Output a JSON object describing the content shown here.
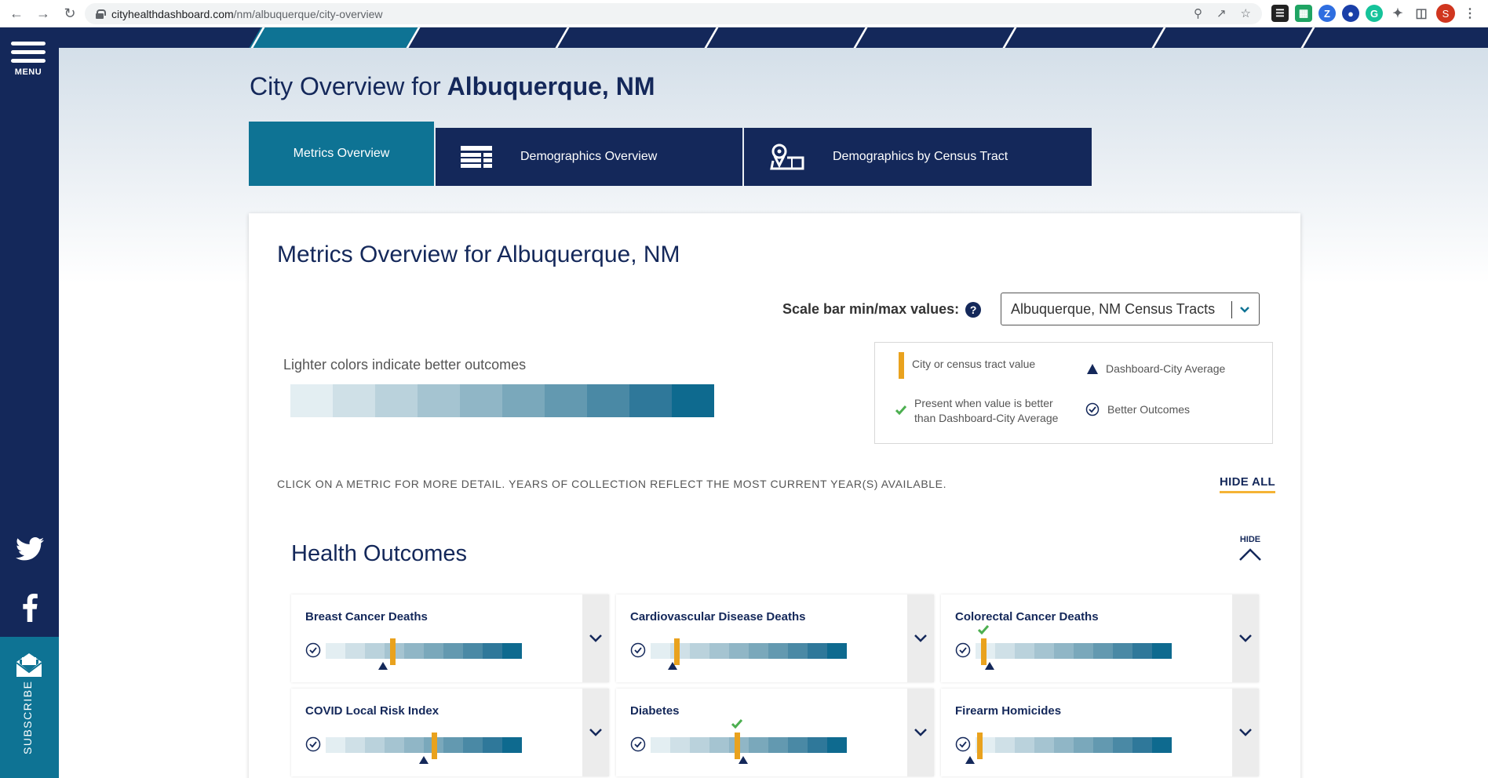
{
  "browser": {
    "url_host": "cityhealthdashboard.com",
    "url_path": "/nm/albuquerque/city-overview",
    "profile_initial": "S"
  },
  "sidebar": {
    "menu_label": "MENU",
    "subscribe_label": "SUBSCRIBE"
  },
  "page": {
    "heading_prefix": "City Overview for",
    "heading_city": "Albuquerque, NM"
  },
  "tabs": [
    {
      "label": "Metrics Overview",
      "icon": "none",
      "active": true
    },
    {
      "label": "Demographics Overview",
      "icon": "table-icon",
      "active": false
    },
    {
      "label": "Demographics by Census Tract",
      "icon": "map-pin-icon",
      "active": false
    }
  ],
  "overview": {
    "title": "Metrics Overview for Albuquerque, NM",
    "scale_label": "Scale bar min/max values:",
    "scale_select_value": "Albuquerque, NM Census Tracts",
    "lighter_label": "Lighter colors indicate better outcomes",
    "scale_colors": [
      "#e3eef2",
      "#cfe0e7",
      "#bad2dc",
      "#a5c4d1",
      "#90b6c6",
      "#7aa8bb",
      "#6399b0",
      "#4a89a5",
      "#2f789a",
      "#0e6a8f"
    ],
    "legend": {
      "tract_value": "City or census tract value",
      "city_average": "Dashboard-City Average",
      "better_than_avg": "Present when value is better than Dashboard-City Average",
      "better_outcomes": "Better Outcomes"
    },
    "instruction": "CLICK ON A METRIC FOR MORE DETAIL. YEARS OF COLLECTION REFLECT THE MOST CURRENT YEAR(S) AVAILABLE.",
    "hide_all_label": "HIDE ALL"
  },
  "section": {
    "title": "Health Outcomes",
    "hide_label": "HIDE"
  },
  "metrics": [
    {
      "name": "Breast Cancer Deaths",
      "tract_position": 0.34,
      "avg_position": 0.29,
      "better": false
    },
    {
      "name": "Cardiovascular Disease Deaths",
      "tract_position": 0.13,
      "avg_position": 0.11,
      "better": false
    },
    {
      "name": "Colorectal Cancer Deaths",
      "tract_position": 0.04,
      "avg_position": 0.07,
      "better": true
    },
    {
      "name": "COVID Local Risk Index",
      "tract_position": 0.55,
      "avg_position": 0.5,
      "better": false
    },
    {
      "name": "Diabetes",
      "tract_position": 0.44,
      "avg_position": 0.47,
      "better": true
    },
    {
      "name": "Firearm Homicides",
      "tract_position": 0.02,
      "avg_position": -0.03,
      "better": false
    }
  ]
}
